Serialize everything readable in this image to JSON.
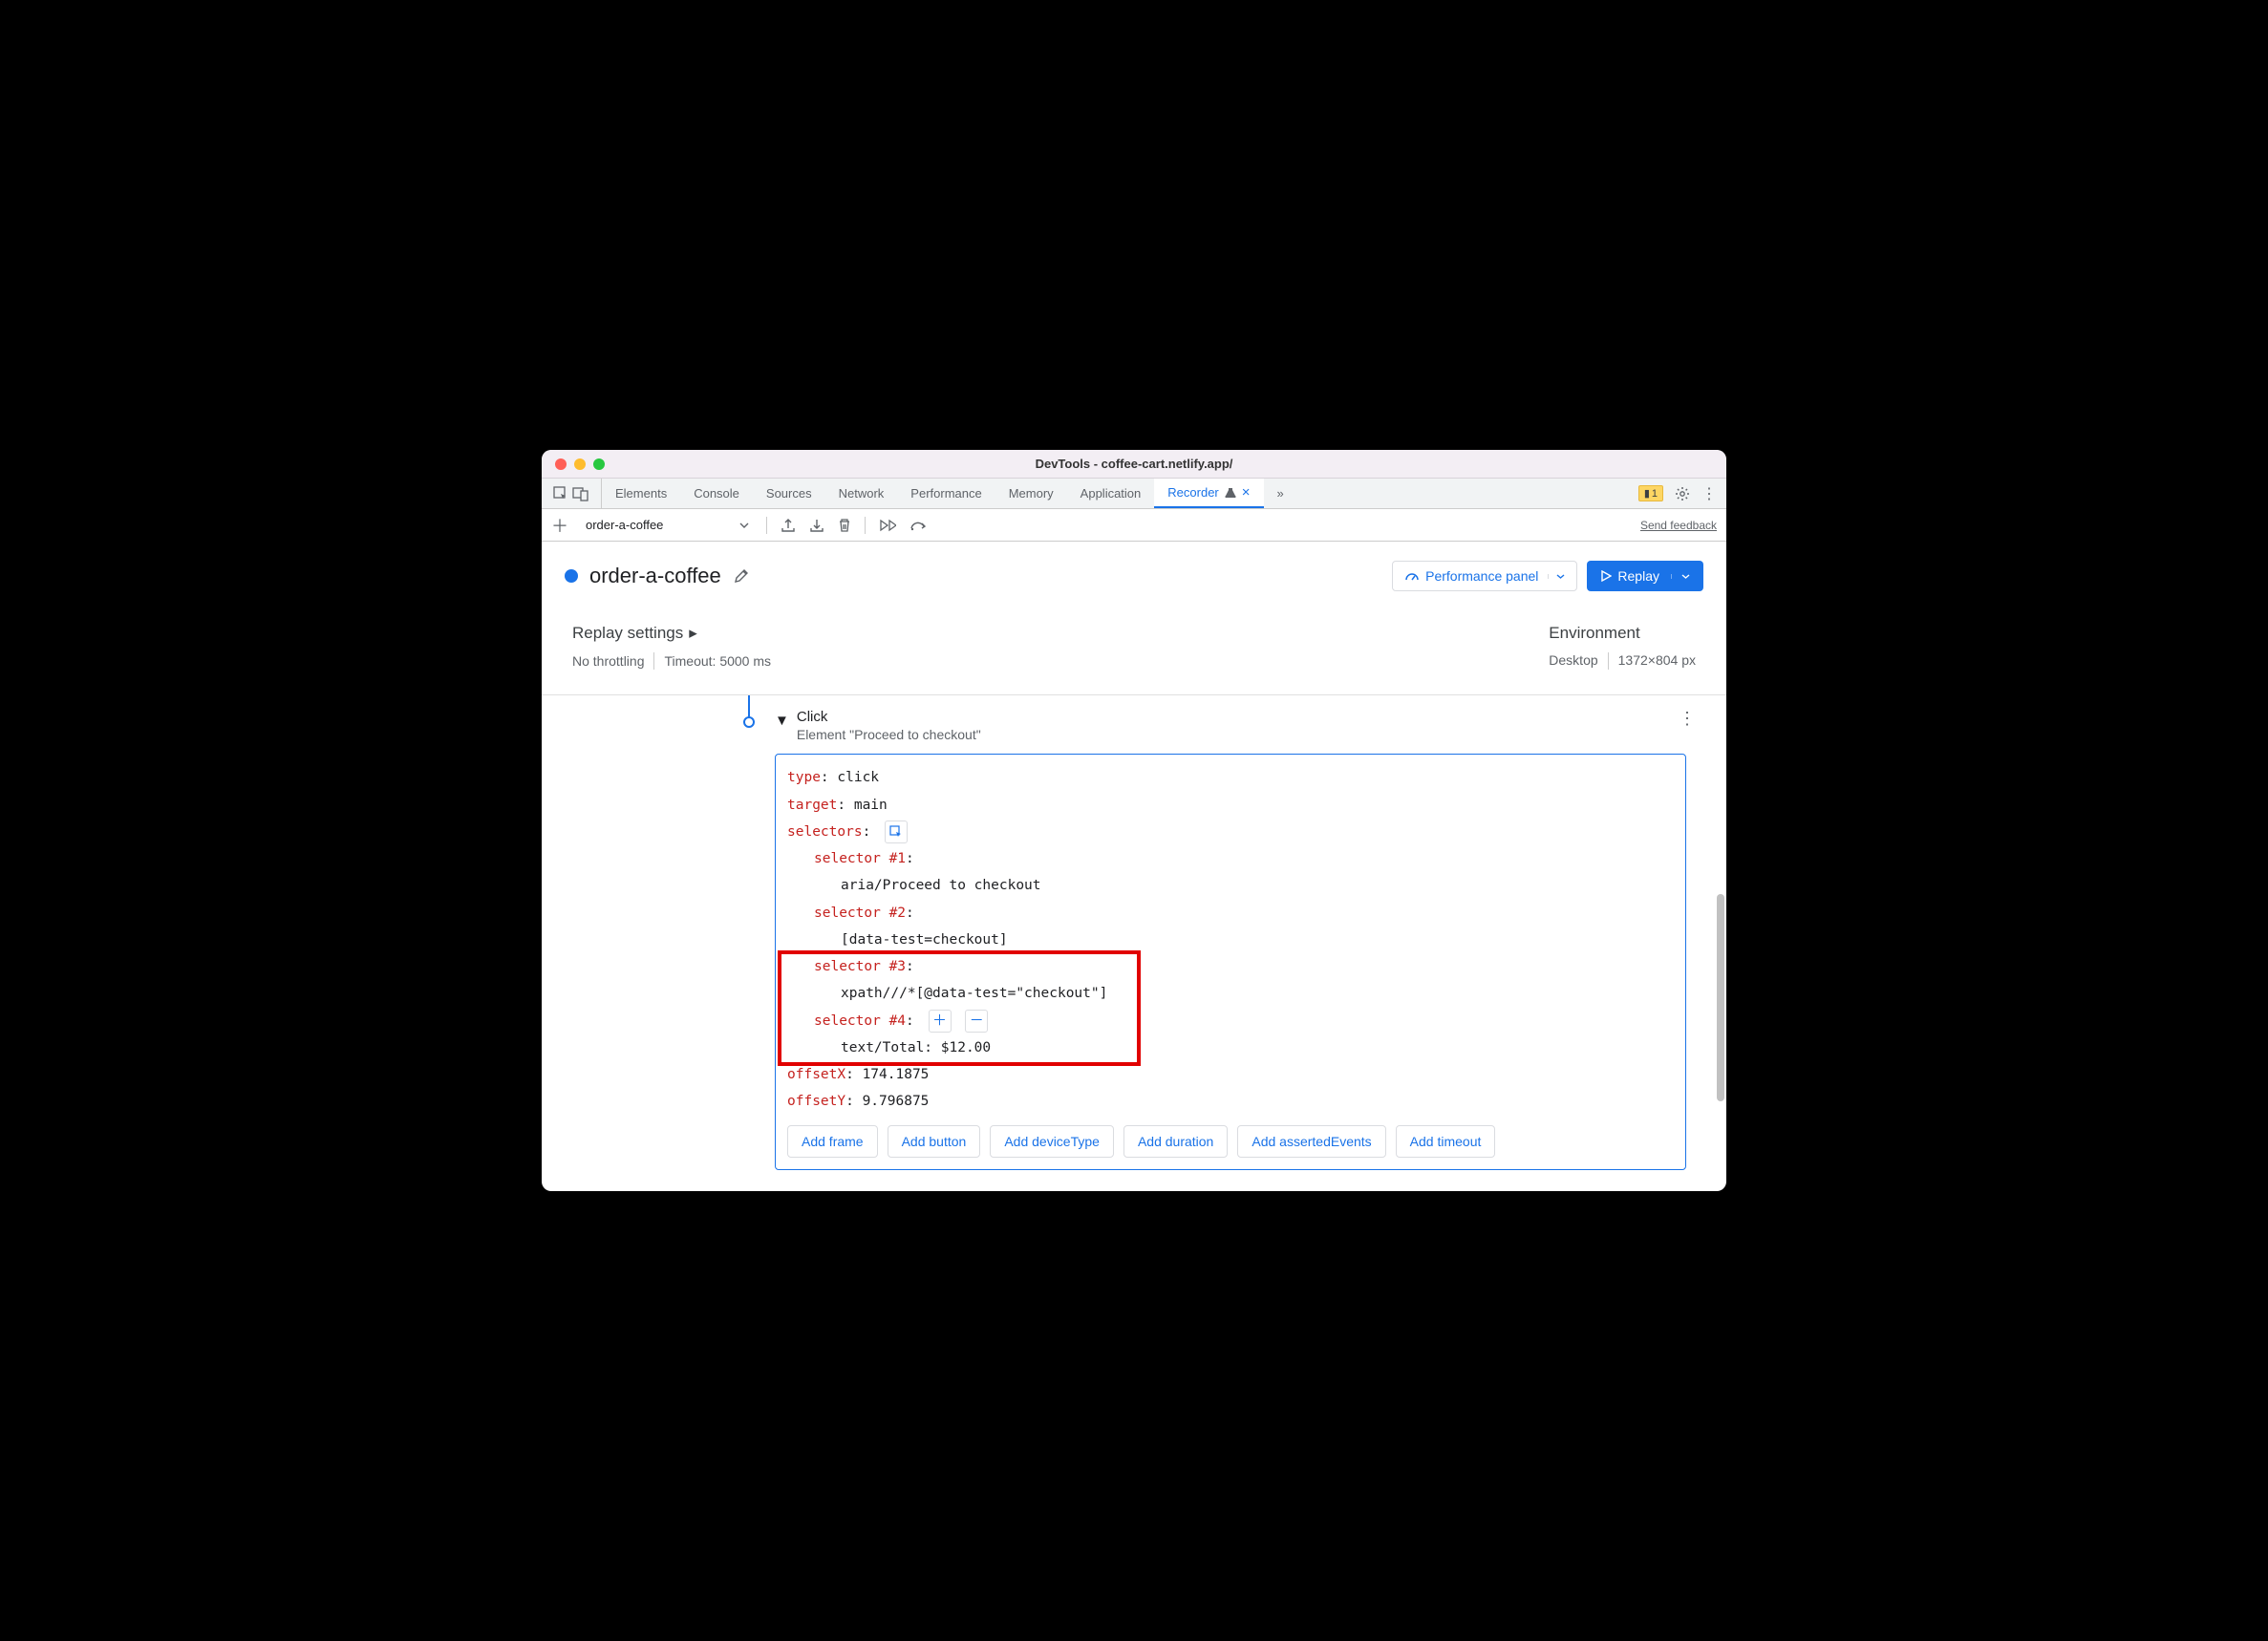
{
  "window": {
    "title": "DevTools - coffee-cart.netlify.app/"
  },
  "tabs": {
    "items": [
      "Elements",
      "Console",
      "Sources",
      "Network",
      "Performance",
      "Memory",
      "Application",
      "Recorder"
    ],
    "active": "Recorder",
    "overflow_glyph": "»",
    "close_glyph": "×",
    "warn_count": "1"
  },
  "toolbar": {
    "recording_name": "order-a-coffee",
    "feedback": "Send feedback"
  },
  "header": {
    "title": "order-a-coffee",
    "perf_btn": "Performance panel",
    "replay_btn": "Replay"
  },
  "settings": {
    "left_title": "Replay settings",
    "throttling": "No throttling",
    "timeout": "Timeout: 5000 ms",
    "right_title": "Environment",
    "device": "Desktop",
    "dims": "1372×804 px"
  },
  "step": {
    "title": "Click",
    "subtitle": "Element \"Proceed to checkout\"",
    "lines": {
      "type_k": "type",
      "type_v": ": click",
      "target_k": "target",
      "target_v": ": main",
      "selectors_k": "selectors",
      "selectors_v": ":",
      "s1_k": "selector #1",
      "s1_v": ":",
      "s1_val": "aria/Proceed to checkout",
      "s2_k": "selector #2",
      "s2_v": ":",
      "s2_val": "[data-test=checkout]",
      "s3_k": "selector #3",
      "s3_v": ":",
      "s3_val": "xpath///*[@data-test=\"checkout\"]",
      "s4_k": "selector #4",
      "s4_v": ":",
      "s4_val": "text/Total: $12.00",
      "ox_k": "offsetX",
      "ox_v": ": 174.1875",
      "oy_k": "offsetY",
      "oy_v": ": 9.796875"
    },
    "add_buttons": [
      "Add frame",
      "Add button",
      "Add deviceType",
      "Add duration",
      "Add assertedEvents",
      "Add timeout"
    ]
  }
}
